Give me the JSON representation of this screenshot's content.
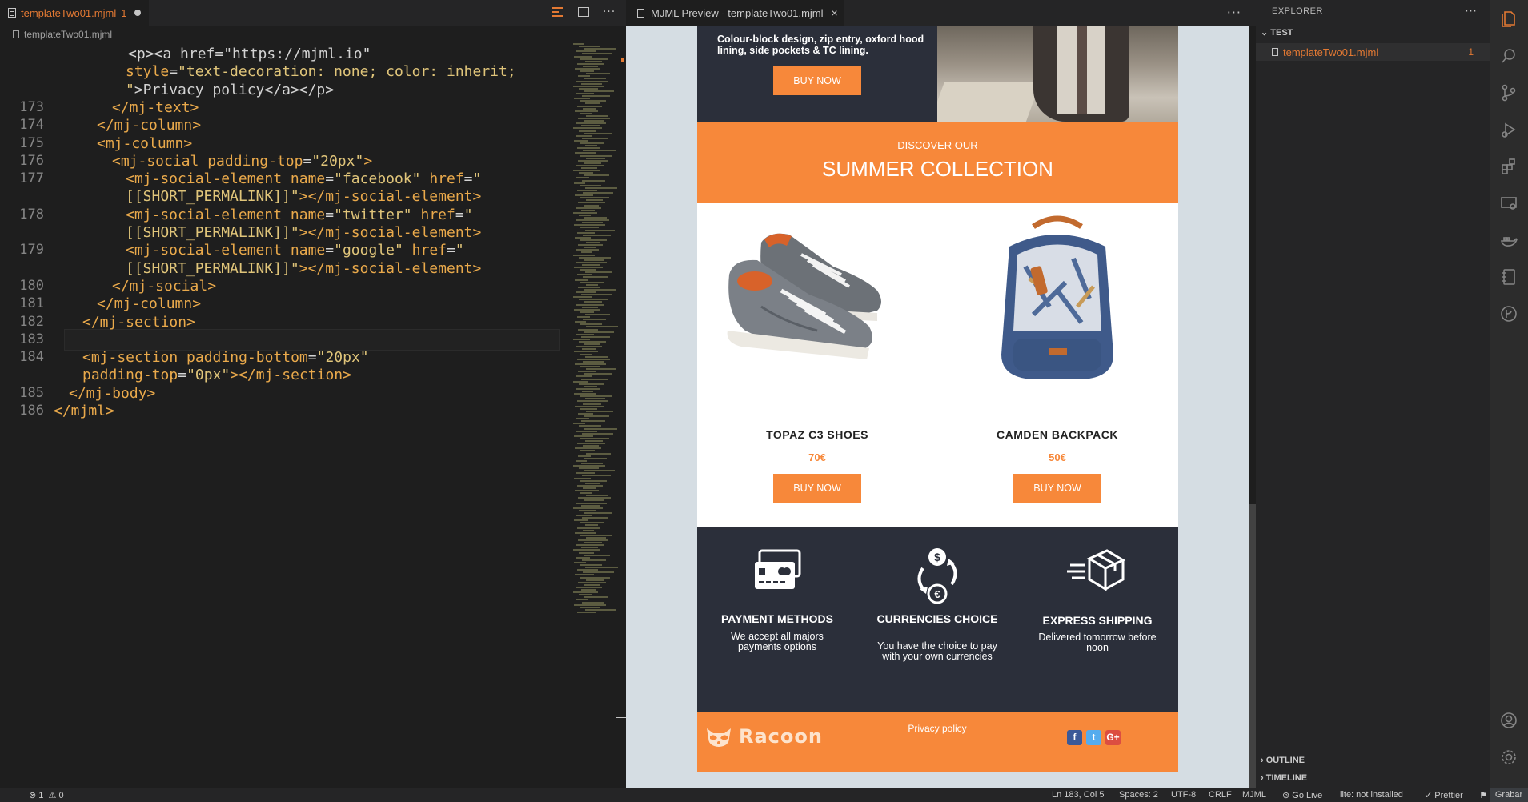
{
  "editor": {
    "tab_label": "templateTwo01.mjml",
    "tab_problem_count": "1",
    "breadcrumb": "templateTwo01.mjml",
    "lines": [
      {
        "n": "",
        "parts": [
          [
            "c-plain",
            "<p><a href=\"https://mjml.io\""
          ]
        ]
      },
      {
        "n": "",
        "parts": [
          [
            "c-attr",
            "style"
          ],
          [
            "c-plain",
            "="
          ],
          [
            "c-str",
            "\"text-decoration: none; color: inherit;"
          ]
        ]
      },
      {
        "n": "",
        "parts": [
          [
            "c-str",
            "\""
          ],
          [
            "c-plain",
            ">Privacy policy</a></p>"
          ]
        ]
      },
      {
        "n": "173",
        "parts": [
          [
            "c-tag",
            "</mj-text>"
          ]
        ]
      },
      {
        "n": "174",
        "parts": [
          [
            "c-tag",
            "</mj-column>"
          ]
        ]
      },
      {
        "n": "175",
        "parts": [
          [
            "c-tag",
            "<mj-column>"
          ]
        ]
      },
      {
        "n": "176",
        "parts": [
          [
            "c-tag",
            "<mj-social "
          ],
          [
            "c-attr",
            "padding-top"
          ],
          [
            "c-plain",
            "="
          ],
          [
            "c-str",
            "\"20px\""
          ],
          [
            "c-tag",
            ">"
          ]
        ]
      },
      {
        "n": "177",
        "parts": [
          [
            "c-tag",
            "<mj-social-element "
          ],
          [
            "c-attr",
            "name"
          ],
          [
            "c-plain",
            "="
          ],
          [
            "c-str",
            "\"facebook\""
          ],
          [
            "c-attr",
            " href"
          ],
          [
            "c-plain",
            "="
          ],
          [
            "c-str",
            "\""
          ]
        ]
      },
      {
        "n": "",
        "parts": [
          [
            "c-str",
            "[[SHORT_PERMALINK]]\""
          ],
          [
            "c-tag",
            "></mj-social-element>"
          ]
        ]
      },
      {
        "n": "178",
        "parts": [
          [
            "c-tag",
            "<mj-social-element "
          ],
          [
            "c-attr",
            "name"
          ],
          [
            "c-plain",
            "="
          ],
          [
            "c-str",
            "\"twitter\""
          ],
          [
            "c-attr",
            " href"
          ],
          [
            "c-plain",
            "="
          ],
          [
            "c-str",
            "\""
          ]
        ]
      },
      {
        "n": "",
        "parts": [
          [
            "c-str",
            "[[SHORT_PERMALINK]]\""
          ],
          [
            "c-tag",
            "></mj-social-element>"
          ]
        ]
      },
      {
        "n": "179",
        "parts": [
          [
            "c-tag",
            "<mj-social-element "
          ],
          [
            "c-attr",
            "name"
          ],
          [
            "c-plain",
            "="
          ],
          [
            "c-str",
            "\"google\""
          ],
          [
            "c-attr",
            " href"
          ],
          [
            "c-plain",
            "="
          ],
          [
            "c-str",
            "\""
          ]
        ]
      },
      {
        "n": "",
        "parts": [
          [
            "c-str",
            "[[SHORT_PERMALINK]]\""
          ],
          [
            "c-tag",
            "></mj-social-element>"
          ]
        ]
      },
      {
        "n": "180",
        "parts": [
          [
            "c-tag",
            "</mj-social>"
          ]
        ]
      },
      {
        "n": "181",
        "parts": [
          [
            "c-tag",
            "</mj-column>"
          ]
        ]
      },
      {
        "n": "182",
        "parts": [
          [
            "c-tag",
            "</mj-section>"
          ]
        ]
      },
      {
        "n": "183",
        "parts": []
      },
      {
        "n": "184",
        "parts": [
          [
            "c-tag",
            "<mj-section "
          ],
          [
            "c-attr",
            "padding-bottom"
          ],
          [
            "c-plain",
            "="
          ],
          [
            "c-str",
            "\"20px\""
          ]
        ]
      },
      {
        "n": "",
        "parts": [
          [
            "c-attr",
            "padding-top"
          ],
          [
            "c-plain",
            "="
          ],
          [
            "c-str",
            "\"0px\""
          ],
          [
            "c-tag",
            "></mj-section>"
          ]
        ]
      },
      {
        "n": "185",
        "parts": [
          [
            "c-tag",
            "</mj-body>"
          ]
        ]
      },
      {
        "n": "186",
        "parts": [
          [
            "c-tag",
            "</mjml>"
          ]
        ]
      }
    ]
  },
  "preview": {
    "tab_label": "MJML Preview - templateTwo01.mjml",
    "hero": {
      "text": "Colour-block design, zip entry, oxford hood lining, side pockets & TC lining.",
      "button": "BUY NOW"
    },
    "collection": {
      "subtitle": "DISCOVER OUR",
      "title": "SUMMER COLLECTION"
    },
    "products": [
      {
        "name": "TOPAZ C3 SHOES",
        "price": "70€",
        "button": "BUY NOW"
      },
      {
        "name": "CAMDEN BACKPACK",
        "price": "50€",
        "button": "BUY NOW"
      }
    ],
    "features": [
      {
        "title": "PAYMENT METHODS",
        "desc": "We accept all majors payments options",
        "icon": "credit-card-icon"
      },
      {
        "title": "CURRENCIES CHOICE",
        "desc": "You have the choice to pay with your own currencies",
        "icon": "currency-exchange-icon"
      },
      {
        "title": "EXPRESS SHIPPING",
        "desc": "Delivered tomorrow before noon",
        "icon": "fast-delivery-icon"
      }
    ],
    "footer": {
      "logo": "Racoon",
      "privacy": "Privacy policy",
      "socials": [
        {
          "name": "facebook",
          "glyph": "f",
          "color": "#3b5998"
        },
        {
          "name": "twitter",
          "glyph": "t",
          "color": "#55acee"
        },
        {
          "name": "google",
          "glyph": "G+",
          "color": "#dc4e41"
        }
      ]
    },
    "colors": {
      "accent": "#f7883a",
      "dark": "#2b2f3a"
    }
  },
  "explorer": {
    "title": "EXPLORER",
    "folder": "TEST",
    "file": "templateTwo01.mjml",
    "file_count": "1",
    "outline": "OUTLINE",
    "timeline": "TIMELINE"
  },
  "status": {
    "errors": "1",
    "warnings": "0",
    "position": "Ln 183, Col 5",
    "spaces": "Spaces: 2",
    "encoding": "UTF-8",
    "eol": "CRLF",
    "language": "MJML",
    "golive": "Go Live",
    "lint": "lite: not installed",
    "prettier": "Prettier",
    "grabber": "Grabar"
  }
}
